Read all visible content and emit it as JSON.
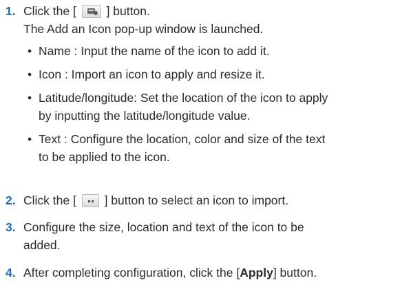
{
  "steps": [
    {
      "number": "1.",
      "text_before": "Click the [",
      "text_after": "] button.",
      "button_icon": "add-icon-button",
      "line2": "The Add an Icon pop-up window is launched.",
      "bullets": [
        {
          "lines": [
            "Name : Input the name of the icon to add it."
          ]
        },
        {
          "lines": [
            "Icon : Import an icon to apply and resize it."
          ]
        },
        {
          "lines": [
            "Latitude/longitude: Set the location of the icon to apply",
            "by inputting the latitude/longitude value."
          ]
        },
        {
          "lines": [
            "Text : Configure the location, color and size of the text",
            "to be applied to the icon."
          ]
        }
      ]
    },
    {
      "number": "2.",
      "text_before": "Click the [",
      "text_after": "] button to select an icon to import.",
      "button_icon": "browse-dots-button"
    },
    {
      "number": "3.",
      "lines": [
        "Configure the size, location and text of the icon to be",
        "added."
      ]
    },
    {
      "number": "4.",
      "text_before": "After completing configuration, click the [",
      "bold_text": "Apply",
      "text_after": "] button."
    }
  ],
  "bullet_symbol": "•",
  "colors": {
    "step_number": "#1e6cc0",
    "text": "#2b2b2b"
  }
}
